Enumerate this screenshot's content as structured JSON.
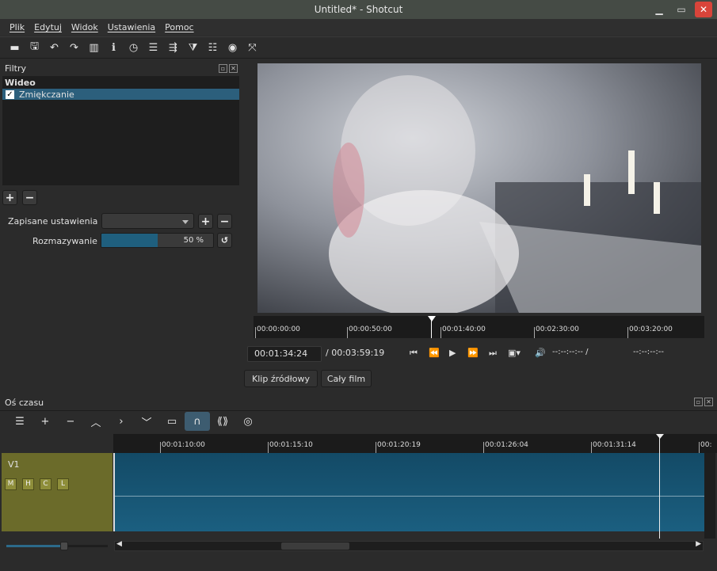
{
  "window": {
    "title": "Untitled* - Shotcut"
  },
  "menu": [
    "Plik",
    "Edytuj",
    "Widok",
    "Ustawienia",
    "Pomoc"
  ],
  "toolbar_icons": [
    "open-icon",
    "save-icon",
    "undo-icon",
    "redo-icon",
    "peak-meter-icon",
    "properties-icon",
    "recent-icon",
    "playlist-icon",
    "history-icon",
    "filters-icon",
    "timeline-icon",
    "encode-icon",
    "fullscreen-icon"
  ],
  "filters_panel": {
    "title": "Filtry",
    "group": "Wideo",
    "items": [
      {
        "label": "Zmiękczanie",
        "checked": true
      }
    ],
    "saved_settings_label": "Zapisane ustawienia",
    "saved_settings_value": "",
    "blur_label": "Rozmazywanie",
    "blur_value_text": "50 %",
    "blur_fraction": 0.5
  },
  "player": {
    "ruler_labels": [
      "00:00:00:00",
      "00:00:50:00",
      "00:01:40:00",
      "00:02:30:00",
      "00:03:20:00"
    ],
    "position": "00:01:34:24",
    "duration": "/ 00:03:59:19",
    "in_point": "--:--:--:-- /",
    "out_point": "--:--:--:--",
    "tab_source": "Klip źródłowy",
    "tab_project": "Cały film"
  },
  "timeline": {
    "title": "Oś czasu",
    "ruler_labels": [
      "00:01:10:00",
      "00:01:15:10",
      "00:01:20:19",
      "00:01:26:04",
      "00:01:31:14",
      "00:"
    ],
    "track_name": "V1",
    "track_buttons": [
      "M",
      "H",
      "C",
      "L"
    ]
  },
  "colors": {
    "accent": "#2c5f7c",
    "track": "#6b6b2a",
    "clip": "#1b5f80"
  }
}
